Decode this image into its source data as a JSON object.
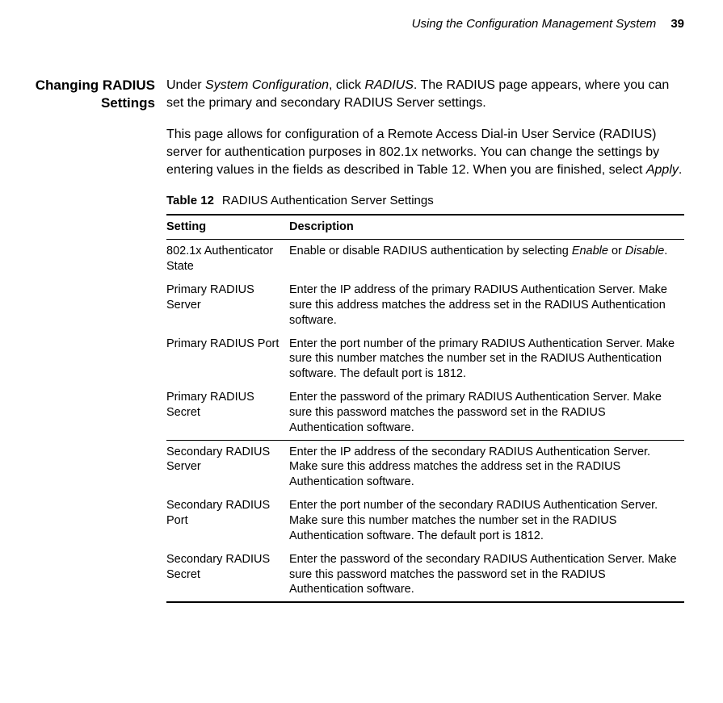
{
  "header": {
    "title": "Using the Configuration Management System",
    "page": "39"
  },
  "section_heading": "Changing RADIUS Settings",
  "para1_prefix": "Under ",
  "para1_em1": "System Configuration",
  "para1_mid": ", click ",
  "para1_em2": "RADIUS",
  "para1_suffix": ". The RADIUS page appears, where you can set the primary and secondary RADIUS Server settings.",
  "para2_prefix": "This page allows for configuration of a Remote Access Dial-in User Service (RADIUS) server for authentication purposes in 802.1x networks. You can change the settings by entering values in the fields as described in Table 12. When you are finished, select ",
  "para2_em": "Apply",
  "para2_suffix": ".",
  "table_label_bold": "Table 12",
  "table_label_rest": "RADIUS Authentication Server Settings",
  "table_header_setting": "Setting",
  "table_header_desc": "Description",
  "rows": [
    {
      "setting": "802.1x Authenticator State",
      "desc_pre": "Enable or disable RADIUS authentication by selecting ",
      "desc_em1": "Enable",
      "desc_mid": " or ",
      "desc_em2": "Disable",
      "desc_post": "."
    },
    {
      "setting": "Primary RADIUS Server",
      "desc": "Enter the IP address of the primary RADIUS Authentication Server. Make sure this address matches the address set in the RADIUS Authentication software."
    },
    {
      "setting": "Primary RADIUS Port",
      "desc": "Enter the port number of the primary RADIUS Authentication Server. Make sure this number matches the number set in the RADIUS Authentication software. The default port is 1812."
    },
    {
      "setting": "Primary RADIUS Secret",
      "desc": "Enter the password of the primary RADIUS Authentication Server. Make sure this password matches the password set in the RADIUS Authentication software."
    },
    {
      "setting": "Secondary RADIUS Server",
      "desc": "Enter the IP address of the secondary RADIUS Authentication Server. Make sure this address matches the address set in the RADIUS Authentication software."
    },
    {
      "setting": "Secondary RADIUS Port",
      "desc": "Enter the port number of the secondary RADIUS Authentication Server. Make sure this number matches the number set in the RADIUS Authentication software. The default port is 1812."
    },
    {
      "setting": "Secondary RADIUS Secret",
      "desc": "Enter the password of the secondary RADIUS Authentication Server. Make sure this password matches the password set in the RADIUS Authentication software."
    }
  ]
}
